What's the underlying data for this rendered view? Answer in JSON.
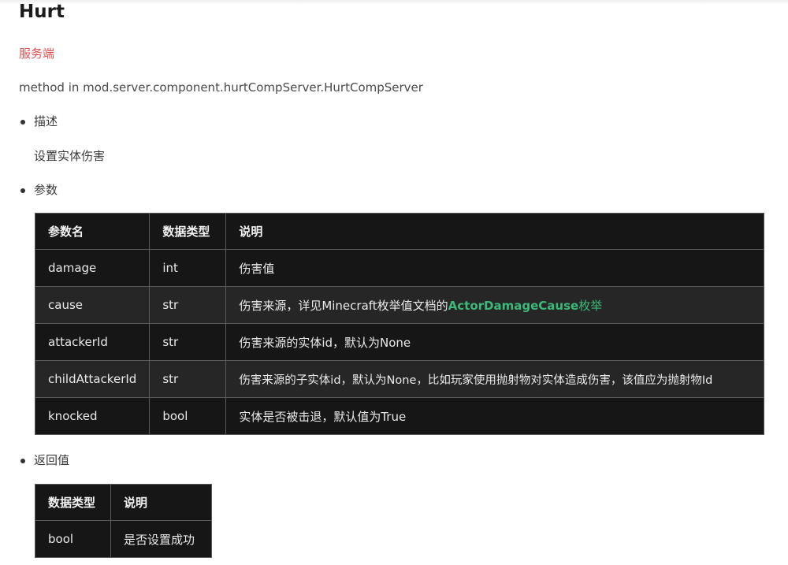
{
  "title": "Hurt",
  "side": "服务端",
  "method": "method in mod.server.component.hurtCompServer.HurtCompServer",
  "sections": {
    "description_label": "描述",
    "description_text": "设置实体伤害",
    "params_label": "参数",
    "return_label": "返回值"
  },
  "params_table": {
    "headers": [
      "参数名",
      "数据类型",
      "说明"
    ],
    "rows": [
      {
        "name": "damage",
        "type": "int",
        "desc": "伤害值"
      },
      {
        "name": "cause",
        "type": "str",
        "desc_prefix": "伤害来源，详见Minecraft枚举值文档的",
        "desc_link": "ActorDamageCause",
        "desc_suffix": "枚举"
      },
      {
        "name": "attackerId",
        "type": "str",
        "desc": "伤害来源的实体id，默认为None"
      },
      {
        "name": "childAttackerId",
        "type": "str",
        "desc": "伤害来源的子实体id，默认为None，比如玩家使用抛射物对实体造成伤害，该值应为抛射物Id"
      },
      {
        "name": "knocked",
        "type": "bool",
        "desc": "实体是否被击退，默认值为True"
      }
    ]
  },
  "return_table": {
    "headers": [
      "数据类型",
      "说明"
    ],
    "rows": [
      {
        "type": "bool",
        "desc": "是否设置成功"
      }
    ]
  },
  "colors": {
    "side_tag": "#e0504f",
    "link": "#3cb878",
    "table_bg": "#161616",
    "table_alt_bg": "#262626"
  }
}
